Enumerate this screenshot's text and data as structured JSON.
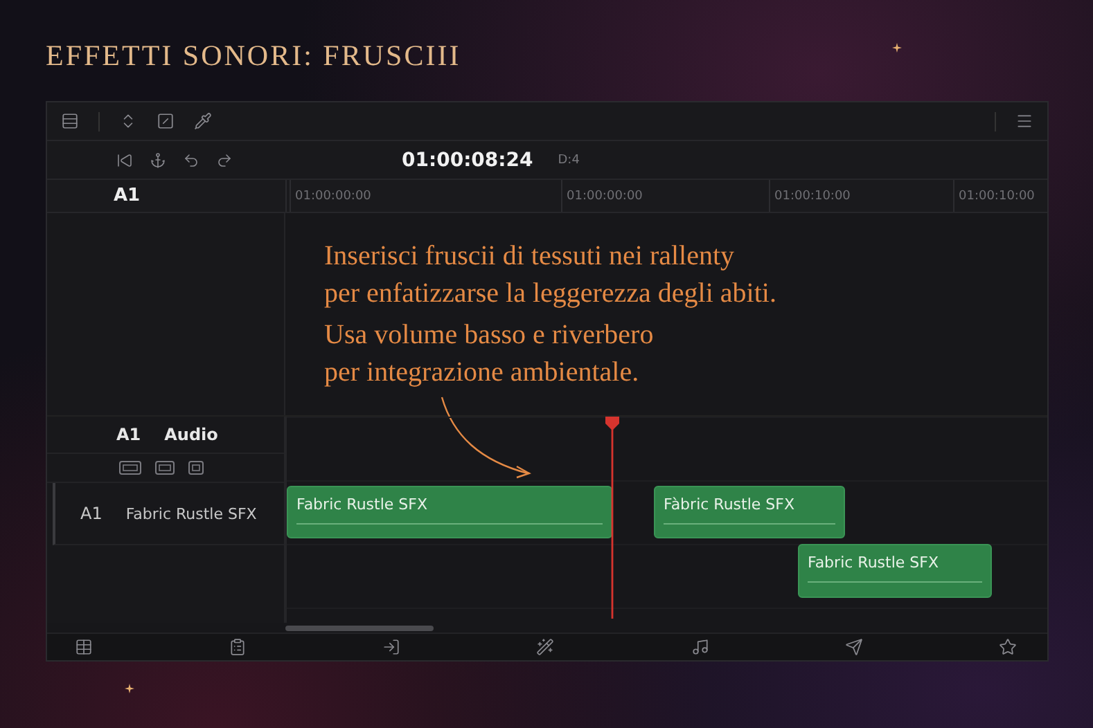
{
  "title": "EFFETTI SONORI: FRUSCIII",
  "timecode": "01:00:08:24",
  "duration": "D:4",
  "ruler": {
    "track": "A1",
    "ticks": [
      "01:00:00:00",
      "01:00:00:00",
      "01:00:10:00",
      "01:00:10:00"
    ]
  },
  "annotation": {
    "paragraphs": [
      "Inserisci fruscii di tessuti nei rallenty\nper enfatizzarse la leggerezza degli abiti.",
      "Usa volume basso e riverbero\nper integrazione ambientale."
    ]
  },
  "track": {
    "id": "A1",
    "label": "Audio",
    "row_id": "A1",
    "name": "Fabric Rustle SFX"
  },
  "clips": [
    {
      "label": "Fabric Rustle SFX"
    },
    {
      "label": "Fàbric Rustle SFX"
    },
    {
      "label": "Fabric Rustle SFX"
    }
  ]
}
